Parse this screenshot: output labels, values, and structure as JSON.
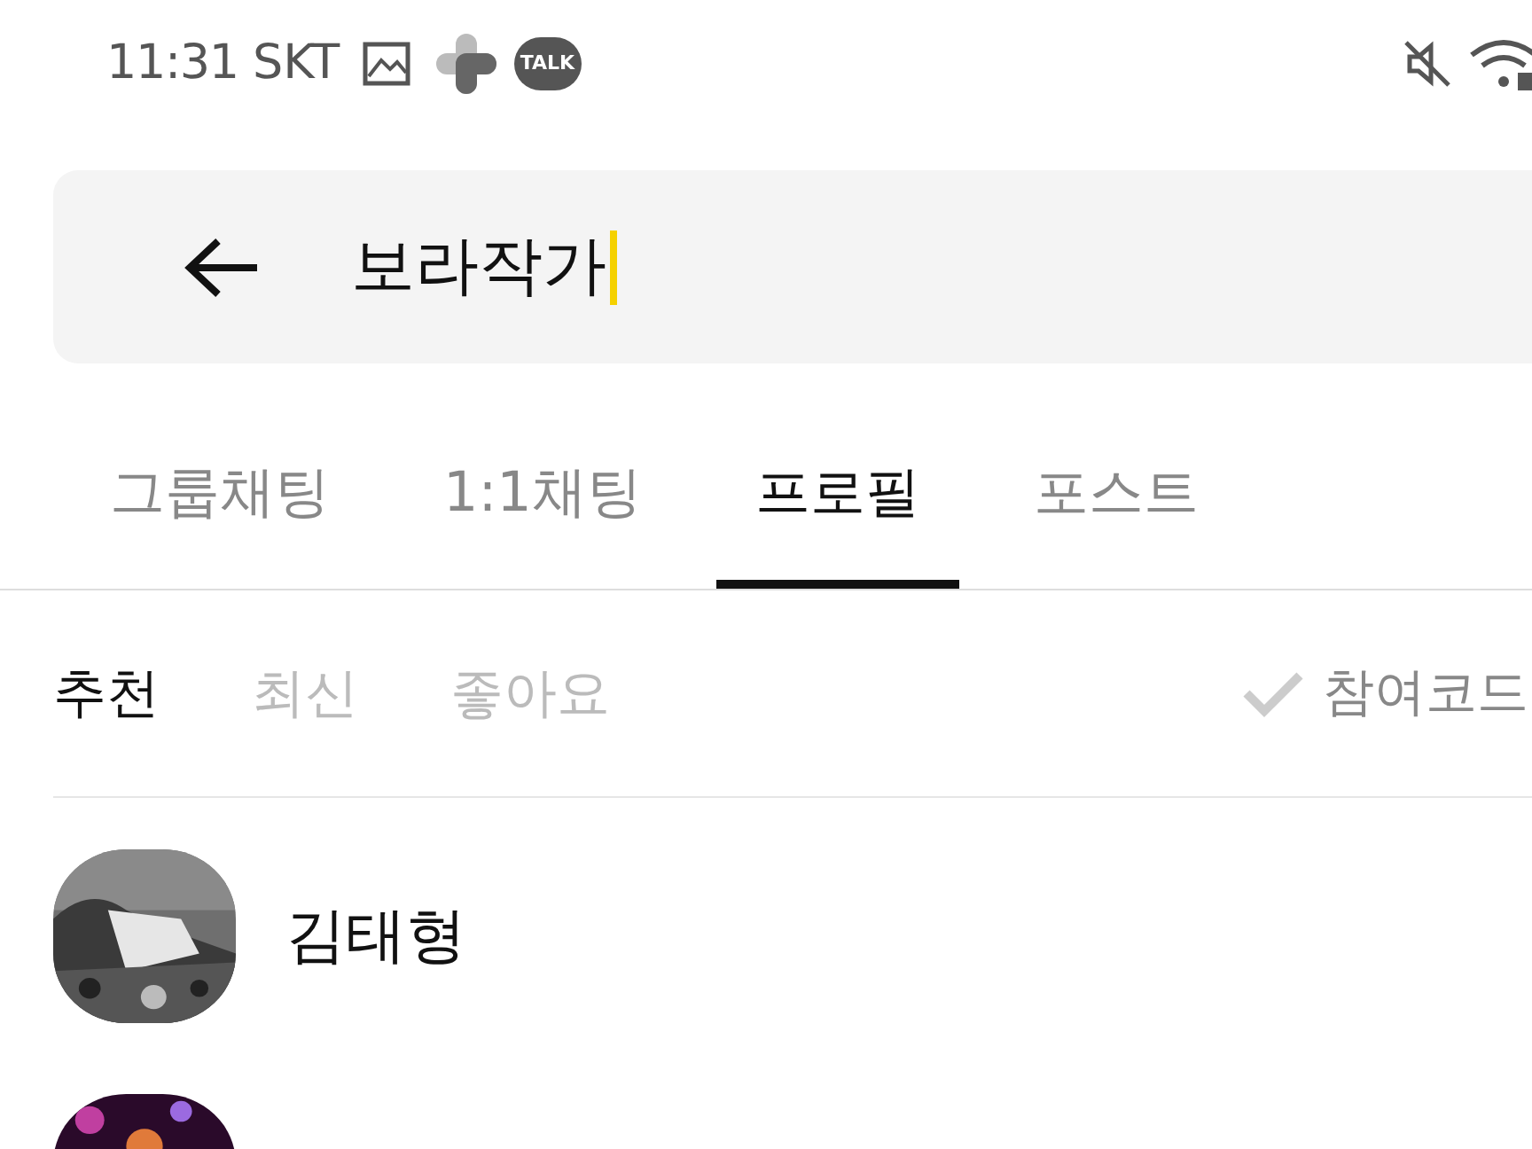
{
  "status_bar": {
    "time": "11:31",
    "carrier": "SKT",
    "talk_badge": "TALK",
    "muted": true
  },
  "search": {
    "value": "보라작가",
    "focused": true
  },
  "tabs": [
    {
      "label": "그룹채팅",
      "selected": false
    },
    {
      "label": "1:1채팅",
      "selected": false
    },
    {
      "label": "프로필",
      "selected": true
    },
    {
      "label": "포스트",
      "selected": false
    }
  ],
  "sort_options": [
    {
      "label": "추천",
      "selected": true
    },
    {
      "label": "최신",
      "selected": false
    },
    {
      "label": "좋아요",
      "selected": false
    }
  ],
  "join_code_filter": {
    "label": "참여코드",
    "checked": false
  },
  "results": [
    {
      "name": "김태형",
      "avatar": {
        "kind": "picture"
      }
    },
    {
      "avatar": {
        "kind": "picture"
      }
    }
  ]
}
